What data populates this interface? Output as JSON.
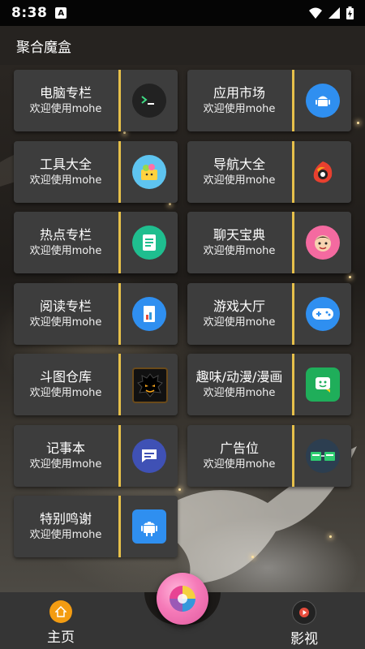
{
  "status": {
    "time": "8:38",
    "notif_badge": "A"
  },
  "appbar": {
    "title": "聚合魔盒"
  },
  "cards": [
    {
      "title": "电脑专栏",
      "subtitle": "欢迎使用mohe",
      "icon": "terminal-icon"
    },
    {
      "title": "应用市场",
      "subtitle": "欢迎使用mohe",
      "icon": "android-robot-icon"
    },
    {
      "title": "工具大全",
      "subtitle": "欢迎使用mohe",
      "icon": "shopping-bag-icon"
    },
    {
      "title": "导航大全",
      "subtitle": "欢迎使用mohe",
      "icon": "weibo-bird-icon"
    },
    {
      "title": "热点专栏",
      "subtitle": "欢迎使用mohe",
      "icon": "notes-icon"
    },
    {
      "title": "聊天宝典",
      "subtitle": "欢迎使用mohe",
      "icon": "cartoon-face-icon"
    },
    {
      "title": "阅读专栏",
      "subtitle": "欢迎使用mohe",
      "icon": "book-icon"
    },
    {
      "title": "游戏大厅",
      "subtitle": "欢迎使用mohe",
      "icon": "gamepad-icon"
    },
    {
      "title": "斗图仓库",
      "subtitle": "欢迎使用mohe",
      "icon": "monster-icon"
    },
    {
      "title": "趣味/动漫/漫画",
      "subtitle": "欢迎使用mohe",
      "icon": "smiley-chat-icon"
    },
    {
      "title": "记事本",
      "subtitle": "欢迎使用mohe",
      "icon": "message-icon"
    },
    {
      "title": "广告位",
      "subtitle": "欢迎使用mohe",
      "icon": "ad-cards-icon"
    },
    {
      "title": "特别鸣谢",
      "subtitle": "欢迎使用mohe",
      "icon": "android-app-icon"
    }
  ],
  "nav": {
    "home_label": "主页",
    "video_label": "影视"
  },
  "colors": {
    "accent_divider": "#e6c04a",
    "card_bg": "#3d3d3d",
    "navbar_bg": "#353535"
  }
}
